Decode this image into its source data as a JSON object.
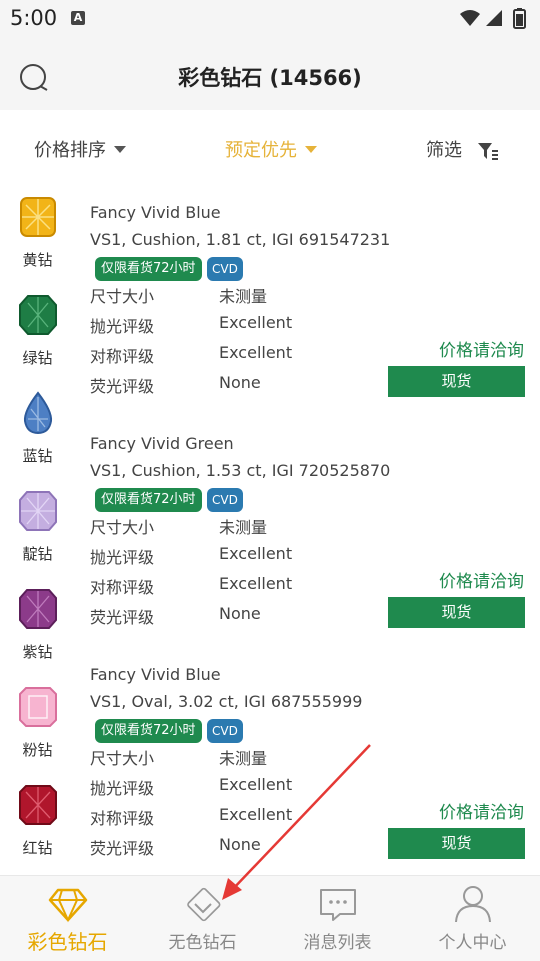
{
  "status": {
    "time": "5:00",
    "notif_letter": "A"
  },
  "header": {
    "title": "彩色钻石 (14566)"
  },
  "filters": {
    "price_sort": "价格排序",
    "priority": "预定优先",
    "filter": "筛选"
  },
  "sidebar": [
    {
      "label": "黄钻",
      "color": "#f2b418"
    },
    {
      "label": "绿钻",
      "color": "#1e7d45"
    },
    {
      "label": "蓝钻",
      "color": "#4d7fc4"
    },
    {
      "label": "靛钻",
      "color": "#b49ad3"
    },
    {
      "label": "紫钻",
      "color": "#8c3b8a"
    },
    {
      "label": "粉钻",
      "color": "#f39ac0"
    },
    {
      "label": "红钻",
      "color": "#b0162c"
    }
  ],
  "cards": [
    {
      "title": "Fancy Vivid Blue",
      "sub": "VS1, Cushion, 1.81 ct, IGI 691547231",
      "badge_view": "仅限看货72小时",
      "badge_type": "CVD",
      "rows": [
        {
          "label": "尺寸大小",
          "value": "未测量"
        },
        {
          "label": "抛光评级",
          "value": "Excellent"
        },
        {
          "label": "对称评级",
          "value": "Excellent"
        },
        {
          "label": "荧光评级",
          "value": "None"
        }
      ],
      "price": "价格请洽询",
      "stock": "现货"
    },
    {
      "title": "Fancy Vivid Green",
      "sub": "VS1, Cushion, 1.53 ct, IGI 720525870",
      "badge_view": "仅限看货72小时",
      "badge_type": "CVD",
      "rows": [
        {
          "label": "尺寸大小",
          "value": "未测量"
        },
        {
          "label": "抛光评级",
          "value": "Excellent"
        },
        {
          "label": "对称评级",
          "value": "Excellent"
        },
        {
          "label": "荧光评级",
          "value": "None"
        }
      ],
      "price": "价格请洽询",
      "stock": "现货"
    },
    {
      "title": "Fancy Vivid Blue",
      "sub": "VS1, Oval, 3.02 ct, IGI 687555999",
      "badge_view": "仅限看货72小时",
      "badge_type": "CVD",
      "rows": [
        {
          "label": "尺寸大小",
          "value": "未测量"
        },
        {
          "label": "抛光评级",
          "value": "Excellent"
        },
        {
          "label": "对称评级",
          "value": "Excellent"
        },
        {
          "label": "荧光评级",
          "value": "None"
        }
      ],
      "price": "价格请洽询",
      "stock": "现货"
    }
  ],
  "tabs": [
    {
      "label": "彩色钻石",
      "icon": "diamond-icon"
    },
    {
      "label": "无色钻石",
      "icon": "diamond-outline-icon"
    },
    {
      "label": "消息列表",
      "icon": "message-icon"
    },
    {
      "label": "个人中心",
      "icon": "person-icon"
    }
  ],
  "colors": {
    "accent": "#e6b33a",
    "green": "#1f8a4e",
    "blue_badge": "#2b7ab0",
    "arrow": "#e53935"
  }
}
